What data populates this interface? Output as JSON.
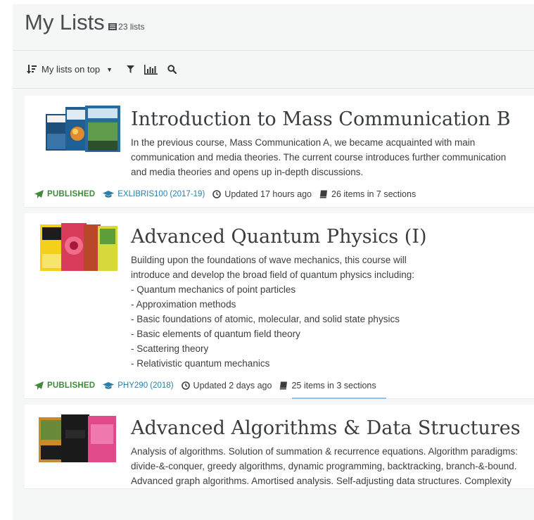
{
  "header": {
    "title": "My Lists",
    "count_label": "23 lists"
  },
  "toolbar": {
    "sort_label": "My lists on top",
    "icons": [
      "sort-icon",
      "caret-down-icon",
      "filter-icon",
      "bar-chart-icon",
      "search-icon"
    ]
  },
  "lists": [
    {
      "title": "Introduction to Mass Communication B",
      "description": [
        "In the previous course, Mass Communication A, we became acquainted with main",
        "communication and media theories. The current course introduces further communication",
        "and media theories and opens up in-depth discussions."
      ],
      "status": "PUBLISHED",
      "course": "EXLIBRIS100 (2017-19)",
      "updated": "Updated 17 hours ago",
      "items": "26 items in 7 sections"
    },
    {
      "title": "Advanced Quantum Physics (I)",
      "description": [
        "Building upon the foundations of wave mechanics, this course will",
        "introduce and develop the broad field of quantum physics including:",
        "- Quantum mechanics of point particles",
        "- Approximation methods",
        "- Basic foundations of atomic, molecular, and solid state physics",
        "- Basic elements of quantum field theory",
        "- Scattering theory",
        "- Relativistic quantum mechanics"
      ],
      "status": "PUBLISHED",
      "course": "PHY290 (2018)",
      "updated": "Updated 2 days ago",
      "items": "25 items in 3 sections"
    },
    {
      "title": "Advanced Algorithms & Data Structures",
      "description": [
        "Analysis of algorithms. Solution of summation & recurrence equations. Algorithm paradigms:",
        "divide-&-conquer, greedy algorithms, dynamic programming, backtracking, branch-&-bound.",
        "Advanced graph algorithms. Amortised analysis. Self-adjusting data structures. Complexity"
      ]
    }
  ],
  "colors": {
    "published": "#3e8a3a",
    "course_link": "#2d7fa6",
    "background": "#f5f6f6",
    "active_underline": "#8fc2e0"
  }
}
